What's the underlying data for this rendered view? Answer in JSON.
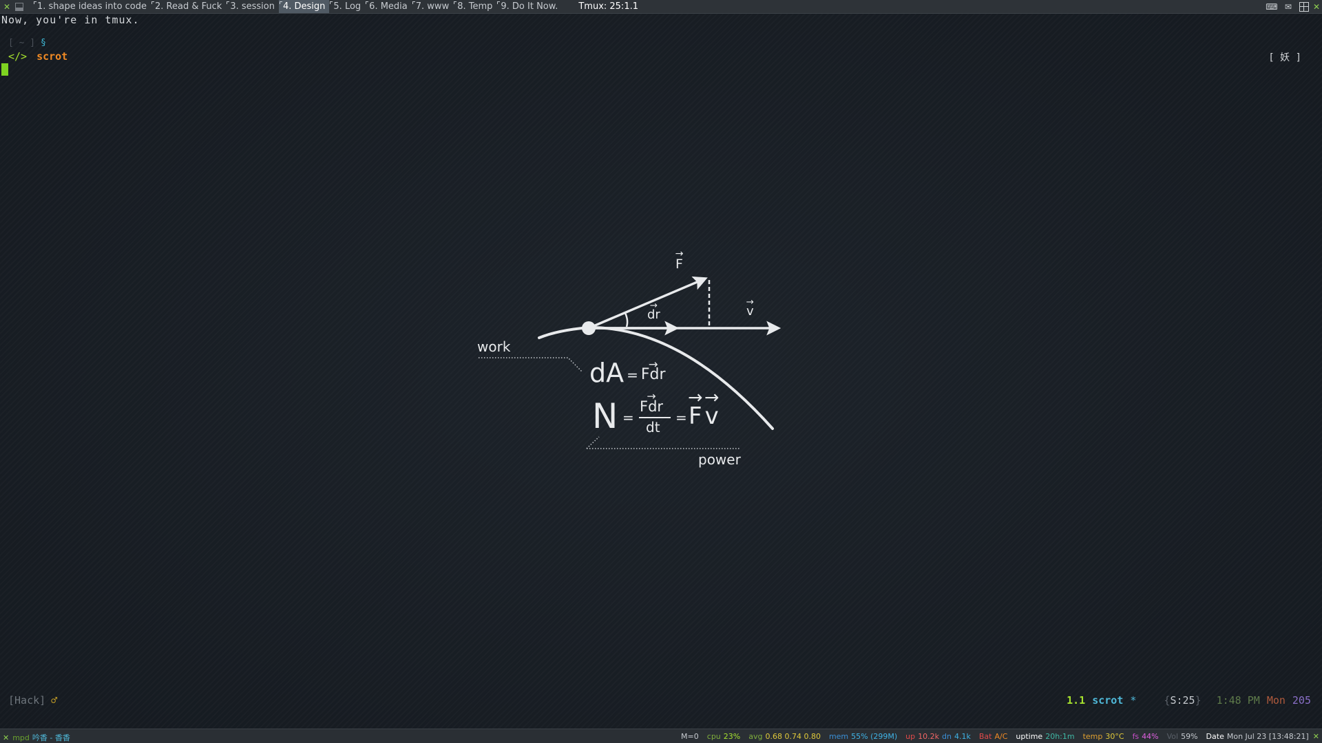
{
  "topbar": {
    "tags": [
      {
        "label": "1. shape ideas into code",
        "active": false
      },
      {
        "label": "2. Read & Fuck",
        "active": false
      },
      {
        "label": "3. session",
        "active": false
      },
      {
        "label": "4. Design",
        "active": true
      },
      {
        "label": "5. Log",
        "active": false
      },
      {
        "label": "6. Media",
        "active": false
      },
      {
        "label": "7. www",
        "active": false
      },
      {
        "label": "8. Temp",
        "active": false
      },
      {
        "label": "9. Do It Now.",
        "active": false
      }
    ],
    "title": "Tmux: 25:1.1",
    "icons": [
      "x-logo-icon",
      "layout-icon",
      "tray-keyboard-icon",
      "tray-chat-icon",
      "grid-icon",
      "close-icon"
    ]
  },
  "terminal": {
    "motd": "Now, you're in tmux.",
    "prompt_dir": "[ ~ ]",
    "prompt_symbol": "§",
    "prompt_tag": "</>",
    "command": "scrot",
    "right_badge": "[ 妖 ]"
  },
  "diagram": {
    "work_label": "work",
    "power_label": "power",
    "force_label": "F",
    "velocity_label": "v",
    "displacement_label": "dr",
    "work_formula": {
      "lhs": "dA",
      "eq": "=",
      "rhs": "Fdr"
    },
    "power_formula": {
      "lhs": "N",
      "eq1": "=",
      "numerator": "Fdr",
      "denominator": "dt",
      "eq2": "=",
      "rhs_f": "F",
      "rhs_v": "v"
    }
  },
  "tmux_status": {
    "session": "[Hack]",
    "gender": "♂",
    "window_index": "1.1",
    "window_name": "scrot",
    "window_flag": "*",
    "session_count": "S:25",
    "clock": "1:48 PM",
    "day": "Mon",
    "day_of_year": "205"
  },
  "system_bar": {
    "mpd_label": "mpd",
    "mpd_song": "吟香 - 香香",
    "m0": "M=0",
    "cpu_label": "cpu",
    "cpu_value": "23%",
    "avg_label": "avg",
    "avg_value": "0.68 0.74 0.80",
    "mem_label": "mem",
    "mem_value": "55% (299M)",
    "up_label": "up",
    "up_value": "10.2k",
    "dn_label": "dn",
    "dn_value": "4.1k",
    "bat_label": "Bat",
    "bat_value": "A/C",
    "uptime_label": "uptime",
    "uptime_value": "20h:1m",
    "temp_label": "temp",
    "temp_value": "30°C",
    "fs_label": "fs",
    "fs_value": "44%",
    "vol_label": "Vol",
    "vol_value": "59%",
    "date_label": "Date",
    "date_value": "Mon Jul 23 [13:48:21]"
  },
  "colors": {
    "background": "#161b21",
    "accent_green": "#a6e22e",
    "accent_orange": "#f08a24",
    "accent_cyan": "#4fb8d8",
    "cursor": "#7ed321",
    "diagram_stroke": "#e8eaec"
  }
}
